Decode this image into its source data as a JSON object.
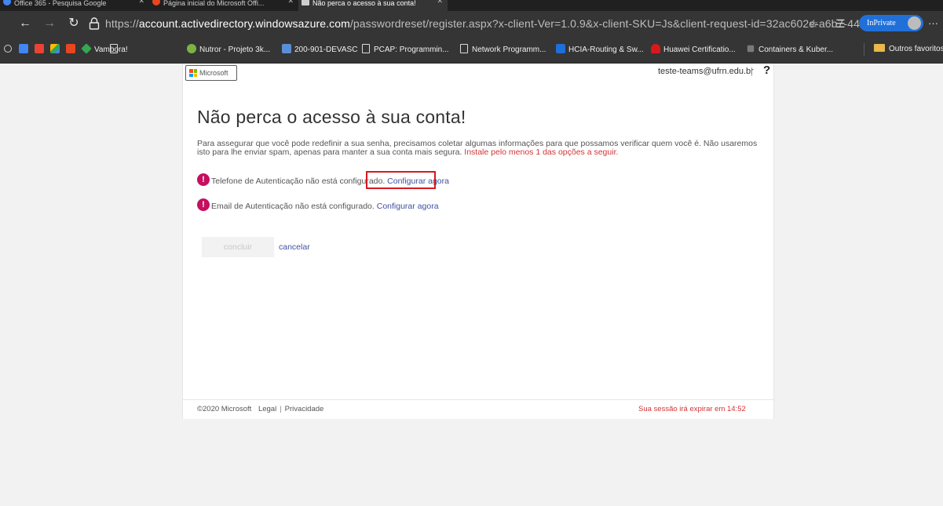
{
  "browser": {
    "tabs": [
      {
        "title": "Office 365 - Pesquisa Google",
        "active": false,
        "favicon_color": "#4285f4"
      },
      {
        "title": "Página inicial do Microsoft Offi...",
        "active": false,
        "favicon_color": "#e8461f"
      },
      {
        "title": "Não perca o acesso à sua conta!",
        "active": true,
        "favicon_color": "#cfcfcf"
      }
    ],
    "url_prefix": "https://",
    "url_domain": "account.activedirectory.windowsazure.com",
    "url_path": "/passwordreset/register.aspx?x-client-Ver=1.0.9&x-client-SKU=Js&client-request-id=32ac602e-a6b7-44...",
    "inprivate_label": "InPrivate",
    "bookmarks": [
      {
        "label": "",
        "icon": "circle-icon",
        "color": "#cfcfcf"
      },
      {
        "label": "",
        "icon": "calendar-icon",
        "color": "#4285f4"
      },
      {
        "label": "",
        "icon": "gmail-icon",
        "color": "#ea4335"
      },
      {
        "label": "",
        "icon": "drive-icon",
        "color": "#fbbc04"
      },
      {
        "label": "",
        "icon": "office-icon",
        "color": "#e8461f"
      },
      {
        "label": "Vambora!",
        "icon": "diamond-icon",
        "color": "#34a853"
      },
      {
        "label": "",
        "icon": "document-icon",
        "color": "#dcdcdc"
      },
      {
        "label": "Nutror - Projeto 3k...",
        "icon": "nutror-icon",
        "color": "#7cb342"
      },
      {
        "label": "200-901-DEVASC",
        "icon": "devasc-icon",
        "color": "#5a8fd6"
      },
      {
        "label": "PCAP: Programmin...",
        "icon": "document-icon",
        "color": "#dcdcdc"
      },
      {
        "label": "Network Programm...",
        "icon": "document-icon",
        "color": "#dcdcdc"
      },
      {
        "label": "HCIA-Routing & Sw...",
        "icon": "hcia-icon",
        "color": "#1e6fd9"
      },
      {
        "label": "Huawei Certificatio...",
        "icon": "huawei-icon",
        "color": "#d7191c"
      },
      {
        "label": "Containers & Kuber...",
        "icon": "containers-icon",
        "color": "#7a7a7a"
      },
      {
        "label": "Outros favoritos",
        "icon": "folder-icon",
        "color": "#e8b84a"
      }
    ]
  },
  "page": {
    "logo_text": "Microsoft",
    "user_email": "teste-teams@ufrn.edu.br",
    "header_separator": "|",
    "help_label": "?",
    "title": "Não perca o acesso à sua conta!",
    "description": "Para assegurar que você pode redefinir a sua senha, precisamos coletar algumas informações para que possamos verificar quem você é. Não usaremos isto para lhe enviar spam, apenas para manter a sua conta mais segura.",
    "description_required": "Instale pelo menos 1 das opções a seguir.",
    "alerts": [
      {
        "text": "Telefone de Autenticação não está configurado.",
        "link": "Configurar agora"
      },
      {
        "text": "Email de Autenticação não está configurado.",
        "link": "Configurar agora"
      }
    ],
    "alert_icon_glyph": "!",
    "finish_button": "concluir",
    "cancel_link": "cancelar",
    "footer": {
      "copyright": "©2020 Microsoft",
      "legal": "Legal",
      "separator": "|",
      "privacy": "Privacidade",
      "session": "Sua sessão irá expirar em 14:52"
    },
    "colors": {
      "alert": "#c50f5f",
      "highlight_box": "#d71920",
      "required_text": "#d13438",
      "link": "#3f51a0"
    }
  }
}
